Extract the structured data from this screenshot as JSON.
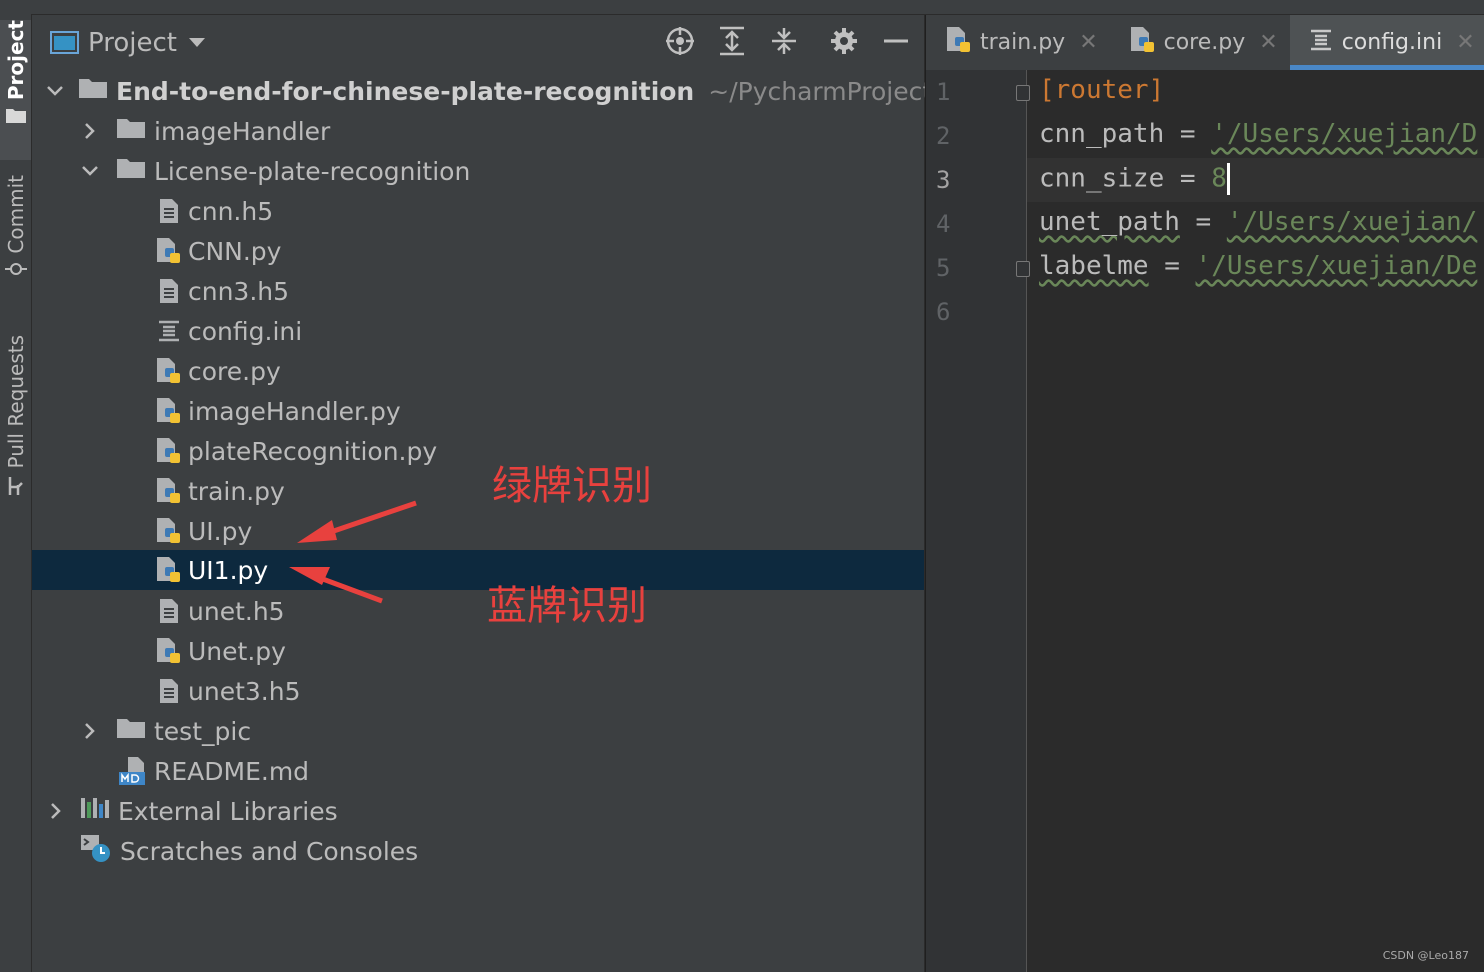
{
  "sidebar": {
    "tabs": [
      {
        "label": "Project"
      },
      {
        "label": "Commit"
      },
      {
        "label": "Pull Requests"
      }
    ]
  },
  "project_panel": {
    "title": "Project",
    "tools": [
      "locate-icon",
      "expand-all-icon",
      "collapse-all-icon",
      "gear-icon",
      "hide-icon"
    ],
    "tree": [
      {
        "label": "End-to-end-for-chinese-plate-recognition",
        "path": "~/PycharmProjects/E"
      },
      {
        "label": "imageHandler"
      },
      {
        "label": "License-plate-recognition"
      },
      {
        "label": "cnn.h5"
      },
      {
        "label": "CNN.py"
      },
      {
        "label": "cnn3.h5"
      },
      {
        "label": "config.ini"
      },
      {
        "label": "core.py"
      },
      {
        "label": "imageHandler.py"
      },
      {
        "label": "plateRecognition.py"
      },
      {
        "label": "train.py"
      },
      {
        "label": "UI.py"
      },
      {
        "label": "UI1.py"
      },
      {
        "label": "unet.h5"
      },
      {
        "label": "Unet.py"
      },
      {
        "label": "unet3.h5"
      },
      {
        "label": "test_pic"
      },
      {
        "label": "README.md"
      },
      {
        "label": "External Libraries"
      },
      {
        "label": "Scratches and Consoles"
      }
    ]
  },
  "annotations": {
    "green_plate": "绿牌识别",
    "blue_plate": "蓝牌识别"
  },
  "editor": {
    "tabs": [
      {
        "label": "train.py"
      },
      {
        "label": "core.py"
      },
      {
        "label": "config.ini"
      }
    ],
    "active_tab": "config.ini",
    "line_numbers": [
      "1",
      "2",
      "3",
      "4",
      "5",
      "6"
    ],
    "lines": {
      "section": "[router]",
      "cnn_path_key": "cnn_path",
      "cnn_path_val": "'/Users/xuejian/D",
      "cnn_size_key": "cnn_size",
      "cnn_size_val": "8",
      "unet_path_key": "unet_path",
      "unet_path_val": "'/Users/xuejian/",
      "labelme_key": "labelme",
      "labelme_val": "'/Users/xuejian/De",
      "eq": "="
    }
  },
  "watermark": "CSDN @Leo187",
  "colors": {
    "selection": "#0d293e",
    "accent": "#4a88c7",
    "annotation": "#e8413e",
    "string": "#6a8759",
    "keyword": "#cc7832",
    "number": "#6897bb"
  }
}
